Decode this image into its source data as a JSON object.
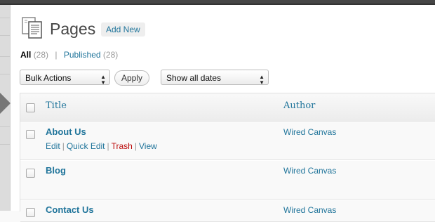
{
  "header": {
    "title": "Pages",
    "add_new_label": "Add New"
  },
  "filters": {
    "all": {
      "label": "All",
      "count": "(28)"
    },
    "separator": "|",
    "published": {
      "label": "Published",
      "count": "(28)"
    }
  },
  "controls": {
    "bulk_actions_selected": "Bulk Actions",
    "apply_label": "Apply",
    "dates_selected": "Show all dates"
  },
  "table": {
    "columns": {
      "title": "Title",
      "author": "Author"
    },
    "rows": [
      {
        "title": "About Us",
        "author": "Wired Canvas",
        "actions": {
          "edit": "Edit",
          "quick_edit": "Quick Edit",
          "trash": "Trash",
          "view": "View",
          "separator": "|"
        }
      },
      {
        "title": "Blog",
        "author": "Wired Canvas"
      },
      {
        "title": "Contact Us",
        "author": "Wired Canvas"
      }
    ]
  },
  "colors": {
    "link": "#21759b",
    "trash": "#bc0b0b",
    "topbar": "#464646"
  },
  "icons": {
    "page": "pages-icon",
    "select_arrows": "updown-arrows-icon",
    "menu_pointer": "menu-pointer-icon"
  }
}
